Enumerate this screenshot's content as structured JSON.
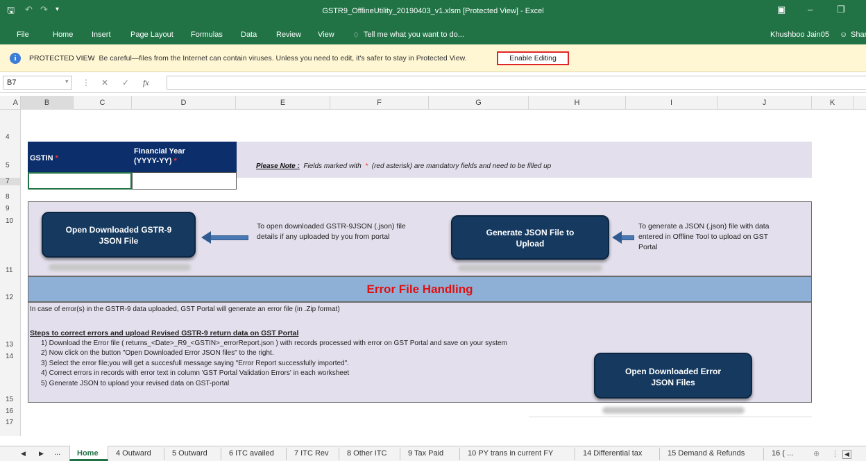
{
  "window": {
    "title": "GSTR9_OfflineUtility_20190403_v1.xlsm  [Protected View] - Excel",
    "user": "Khushboo Jain05",
    "share": "Shar"
  },
  "ribbon": {
    "tabs": [
      "File",
      "Home",
      "Insert",
      "Page Layout",
      "Formulas",
      "Data",
      "Review",
      "View"
    ],
    "tellme": "Tell me what you want to do..."
  },
  "protected_view": {
    "label": "PROTECTED VIEW",
    "message": "Be careful—files from the Internet can contain viruses. Unless you need to edit, it's safer to stay in Protected View.",
    "button": "Enable Editing"
  },
  "formula_bar": {
    "name_box": "B7",
    "fx": "fx",
    "value": ""
  },
  "columns": [
    "A",
    "B",
    "C",
    "D",
    "E",
    "F",
    "G",
    "H",
    "I",
    "J",
    "K"
  ],
  "rows": [
    "4",
    "5",
    "7",
    "8",
    "9",
    "10",
    "11",
    "12",
    "13",
    "14",
    "15",
    "16",
    "17"
  ],
  "form": {
    "gstin_label": "GSTIN",
    "fy_label_1": "Financial Year",
    "fy_label_2": "(YYYY-YY)",
    "asterisk": "*",
    "note_label": "Please Note :",
    "note_text_1": "Fields marked with",
    "note_text_2": "(red asterisk) are mandatory fields and need to be filled up"
  },
  "actions": {
    "open_json_label_1": "Open Downloaded GSTR-9",
    "open_json_label_2": "JSON File",
    "open_json_desc_1": "To open downloaded GSTR-9JSON (.json) file",
    "open_json_desc_2": "details if any uploaded by you from portal",
    "generate_label_1": "Generate JSON File to",
    "generate_label_2": "Upload",
    "generate_desc_1": "To generate a JSON (.json) file with data",
    "generate_desc_2": "entered in Offline Tool to upload on GST",
    "generate_desc_3": "Portal"
  },
  "error_section": {
    "title": "Error File Handling",
    "intro": "In case of error(s) in the GSTR-9 data uploaded, GST Portal will generate an error file (in .Zip format)",
    "steps_heading": "Steps to correct errors and upload Revised GSTR-9 return data on GST Portal",
    "step1": "1) Download the Error file  ( returns_<Date>_R9_<GSTIN>_errorReport.json ) with records processed with error on GST Portal and save on your system",
    "step2": "2) Now click on the button \"Open Downloaded Error JSON files\" to the right.",
    "step3": "3) Select the error file;you will get a succesfull message saying \"Error Report successfully imported\".",
    "step4": "4) Correct errors in records with error text in column 'GST Portal Validation Errors' in each worksheet",
    "step5": "5) Generate JSON to upload your revised data on GST-portal",
    "open_error_label_1": "Open Downloaded Error",
    "open_error_label_2": "JSON Files"
  },
  "sheet_tabs": {
    "ellipsis": "...",
    "tabs": [
      "Home",
      "4 Outward",
      "5 Outward",
      "6 ITC availed",
      "7 ITC Rev",
      "8 Other ITC",
      "9 Tax Paid",
      "10 PY trans in current FY",
      "14 Differential tax",
      "15 Demand & Refunds",
      "16 ( ..."
    ]
  },
  "colors": {
    "excel_green": "#217346",
    "navy": "#0c2f6c",
    "button_blue": "#163a5f",
    "lavender": "#e3dfec",
    "error_red": "#e01010"
  }
}
